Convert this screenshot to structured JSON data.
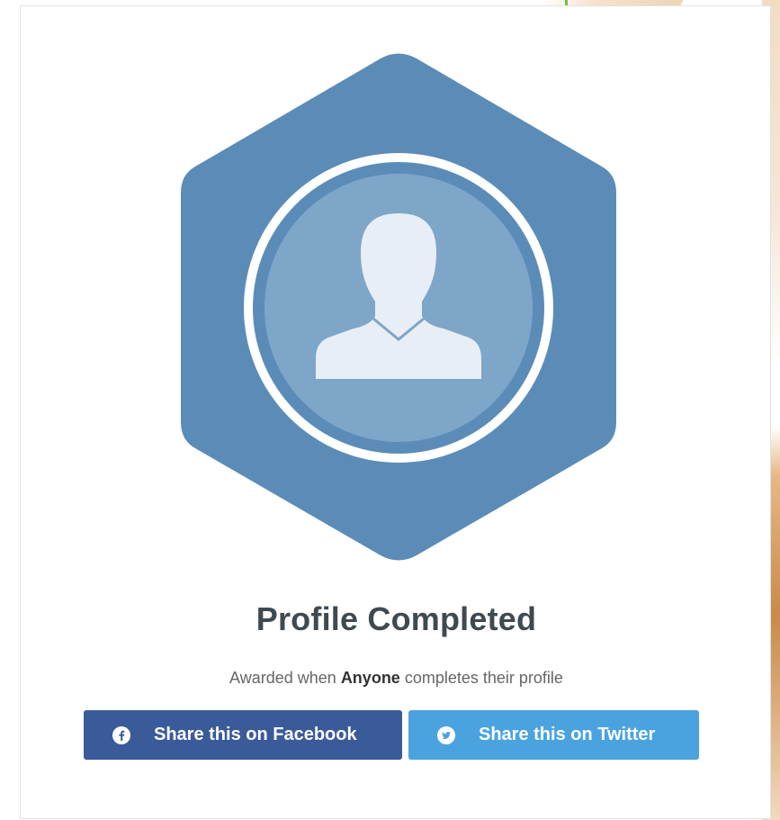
{
  "badge": {
    "icon": "user-silhouette-icon",
    "hexagon_color": "#5b8cb8",
    "inner_circle_color": "#7ea6c9",
    "silhouette_color": "#e8eef5"
  },
  "title": "Profile Completed",
  "subtitle": {
    "prefix": "Awarded when",
    "emphasis": "Anyone",
    "suffix": "completes their profile"
  },
  "buttons": {
    "facebook": {
      "label": "Share this on Facebook",
      "icon": "facebook-icon",
      "color": "#3b5a9a"
    },
    "twitter": {
      "label": "Share this on Twitter",
      "icon": "twitter-icon",
      "color": "#4aa3df"
    }
  }
}
